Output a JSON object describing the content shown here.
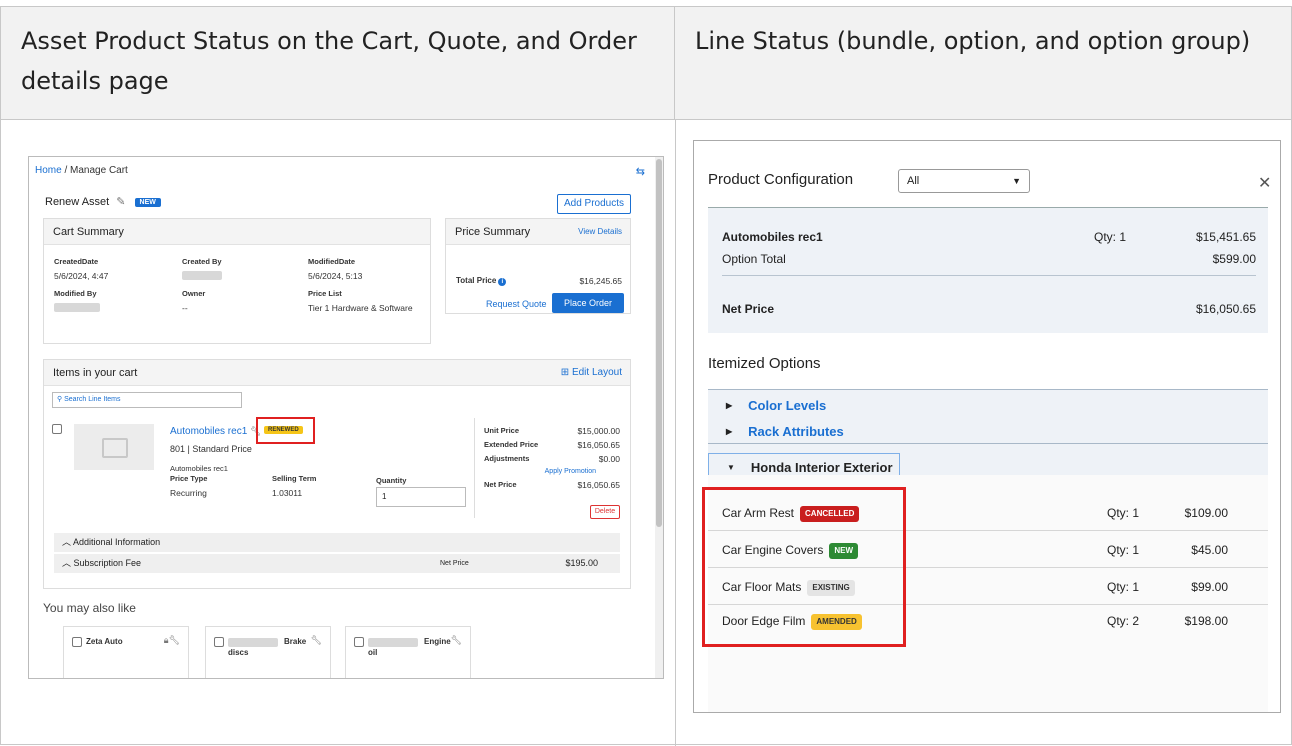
{
  "headers": {
    "left": "Asset Product Status on the Cart, Quote, and Order details page",
    "right": "Line Status (bundle, option, and option group)"
  },
  "cart": {
    "breadcrumb": {
      "home": "Home",
      "sep": " / ",
      "current": "Manage Cart"
    },
    "title": "Renew Asset",
    "new_badge": "NEW",
    "add_products": "Add Products",
    "summary": {
      "title": "Cart Summary",
      "created_date_label": "CreatedDate",
      "created_date": "5/6/2024, 4:47",
      "created_by_label": "Created By",
      "modified_date_label": "ModifiedDate",
      "modified_date": "5/6/2024, 5:13",
      "modified_by_label": "Modified By",
      "owner_label": "Owner",
      "owner": "--",
      "price_list_label": "Price List",
      "price_list": "Tier 1 Hardware & Software"
    },
    "price_summary": {
      "title": "Price Summary",
      "view_details": "View Details",
      "total_label": "Total Price",
      "total": "$16,245.65",
      "request_quote": "Request Quote",
      "place_order": "Place Order"
    },
    "items": {
      "title": "Items in your cart",
      "edit_layout": "Edit Layout",
      "search_placeholder": "Search Line Items",
      "product_name": "Automobiles rec1",
      "status": "RENEWED",
      "price_line": "801 | Standard Price",
      "sub_name": "Automobiles rec1",
      "price_type_label": "Price Type",
      "price_type": "Recurring",
      "selling_term_label": "Selling Term",
      "selling_term": "1.03011",
      "quantity_label": "Quantity",
      "quantity": "1",
      "unit_price_label": "Unit Price",
      "unit_price": "$15,000.00",
      "extended_price_label": "Extended Price",
      "extended_price": "$16,050.65",
      "adjustments_label": "Adjustments",
      "adjustments": "$0.00",
      "apply_promotion": "Apply Promotion",
      "net_price_label": "Net Price",
      "net_price": "$16,050.65",
      "delete": "Delete",
      "additional_info": "Additional Information",
      "subscription_fee": "Subscription Fee",
      "sub_net_price_label": "Net Price",
      "sub_net_price": "$195.00"
    },
    "may_like": {
      "title": "You may also like",
      "cards": [
        {
          "name": "Zeta Auto"
        },
        {
          "name": "Brake",
          "sub": "discs"
        },
        {
          "name": "Engine",
          "sub": "oil"
        }
      ]
    }
  },
  "config": {
    "title": "Product Configuration",
    "filter": "All",
    "summary": {
      "product": "Automobiles rec1",
      "qty": "Qty: 1",
      "product_price": "$15,451.65",
      "option_total_label": "Option Total",
      "option_total": "$599.00",
      "net_price_label": "Net Price",
      "net_price": "$16,050.65"
    },
    "itemized_title": "Itemized Options",
    "groups": [
      "Color Levels",
      "Rack Attributes",
      "Honda Interior  Exterior"
    ],
    "options": [
      {
        "name": "Car Arm Rest",
        "status": "CANCELLED",
        "qty": "Qty: 1",
        "price": "$109.00"
      },
      {
        "name": "Car Engine Covers",
        "status": "NEW",
        "qty": "Qty: 1",
        "price": "$45.00"
      },
      {
        "name": "Car Floor Mats",
        "status": "EXISTING",
        "qty": "Qty: 1",
        "price": "$99.00"
      },
      {
        "name": "Door Edge Film",
        "status": "AMENDED",
        "qty": "Qty: 2",
        "price": "$198.00"
      }
    ]
  },
  "colors": {
    "accent": "#1a6fd1",
    "highlight": "#e02020"
  }
}
